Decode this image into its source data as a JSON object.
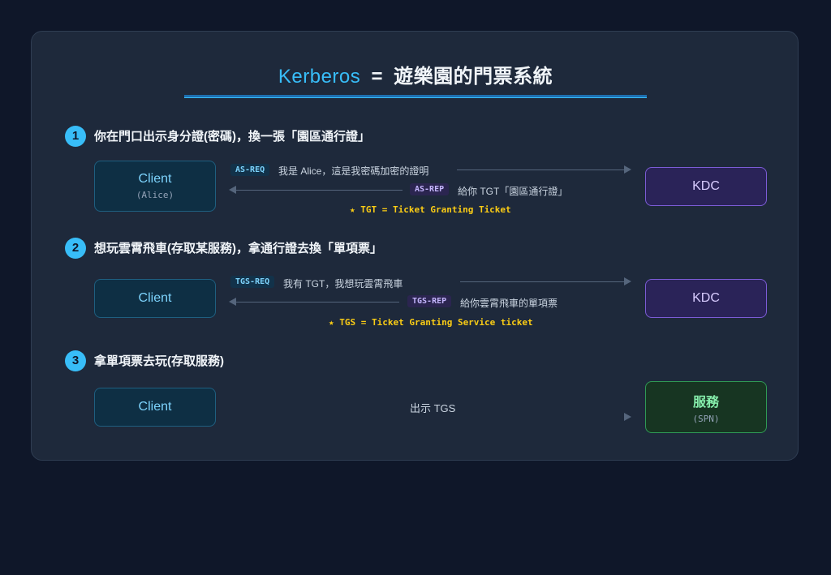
{
  "title": {
    "keyword": "Kerberos",
    "eq": "=",
    "rest": "遊樂園的門票系統"
  },
  "steps": [
    {
      "num": "1",
      "title": "你在門口出示身分證(密碼)，換一張「園區通行證」",
      "left": {
        "name": "Client",
        "sub": "(Alice)"
      },
      "right": {
        "name": "KDC"
      },
      "req": {
        "tag": "AS-REQ",
        "text": "我是 Alice，這是我密碼加密的證明"
      },
      "rep": {
        "tag": "AS-REP",
        "text": "給你 TGT「園區通行證」"
      },
      "note": "★ TGT = Ticket Granting Ticket"
    },
    {
      "num": "2",
      "title": "想玩雲霄飛車(存取某服務)，拿通行證去換「單項票」",
      "left": {
        "name": "Client"
      },
      "right": {
        "name": "KDC"
      },
      "req": {
        "tag": "TGS-REQ",
        "text": "我有 TGT，我想玩雲霄飛車"
      },
      "rep": {
        "tag": "TGS-REP",
        "text": "給你雲霄飛車的單項票"
      },
      "note": "★ TGS = Ticket Granting Service ticket"
    },
    {
      "num": "3",
      "title": "拿單項票去玩(存取服務)",
      "left": {
        "name": "Client"
      },
      "right": {
        "name": "服務",
        "sub": "(SPN)"
      },
      "req": {
        "text": "出示 TGS"
      }
    }
  ],
  "colors": {
    "accent": "#38bdf8",
    "client": "#7dd3fc",
    "kdc": "#c4b5fd",
    "service": "#86efac",
    "note": "#facc15",
    "background": "#0f1729",
    "card": "#1e293b"
  }
}
